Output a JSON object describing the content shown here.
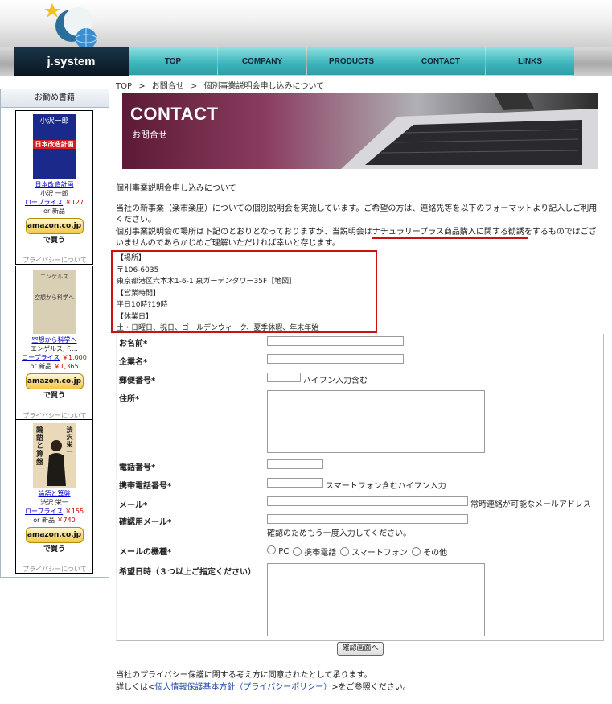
{
  "logo": {
    "text": "j.system"
  },
  "nav": [
    "TOP",
    "COMPANY",
    "PRODUCTS",
    "CONTACT",
    "LINKS"
  ],
  "breadcrumb": [
    "TOP",
    ">",
    "お問合せ",
    ">",
    "個別事業説明会申し込みについて"
  ],
  "sidebar": {
    "title": "お勧め書籍",
    "books": [
      {
        "cover_top": "小沢一郎",
        "cover_main": "日本改造計画",
        "title": "日本改造計画",
        "author": "小沢 一郎",
        "price_label": "ロープライス",
        "price": "￥127",
        "new_label": "or 新品",
        "new_price": "",
        "amazon": "amazon.co.jp で買う",
        "privacy": "プライバシーについて"
      },
      {
        "cover_top": "エンゲルス",
        "cover_main": "空想から科学へ",
        "title": "空想から科学へ",
        "author": "エンゲルス, F.…",
        "price_label": "ロープライス",
        "price": "￥1,000",
        "new_label": "or 新品",
        "new_price": "￥1,365",
        "amazon": "amazon.co.jp で買う",
        "privacy": "プライバシーについて"
      },
      {
        "cover_top": "渋沢栄一",
        "cover_main": "論語と算盤",
        "title": "論語と算盤",
        "author": "渋沢 栄一",
        "price_label": "ロープライス",
        "price": "￥155",
        "new_label": "or 新品",
        "new_price": "￥740",
        "amazon": "amazon.co.jp で買う",
        "privacy": "プライバシーについて"
      }
    ]
  },
  "banner": {
    "title": "CONTACT",
    "subtitle": "お問合せ"
  },
  "page": {
    "heading": "個別事業説明会申し込みについて",
    "intro1": "当社の新事業（楽市楽座）についての個別説明会を実施しています。ご希望の方は、連絡先等を以下のフォーマットより記入しご利用ください。",
    "intro2": "個別事業説明会の場所は下記のとおりとなっておりますが、当説明会はナチュラリープラス商品購入に関する勧誘をするものではございませんのであらかじめご理解いただければ幸いと存じます。"
  },
  "info": {
    "place_label": "【場所】",
    "postal": "〒106-6035",
    "address": "東京都港区六本木1-6-1 泉ガーデンタワー35F［地図］",
    "hours_label": "【営業時間】",
    "hours": "平日10時?19時",
    "holiday_label": "【休業日】",
    "holidays": "土・日曜日、祝日、ゴールデンウィーク、夏季休暇、年末年始"
  },
  "form": {
    "name": "お名前*",
    "company": "企業名*",
    "zip": "郵便番号*",
    "zip_note": "ハイフン入力含む",
    "address": "住所*",
    "phone": "電話番号*",
    "mobile": "携帯電話番号*",
    "mobile_note": "スマートフォン含むハイフン入力",
    "email": "メール*",
    "email_note": "常時連絡が可能なメールアドレス",
    "email_confirm": "確認用メール*",
    "email_confirm_note": "確認のためもう一度入力してください。",
    "device": "メールの機種*",
    "device_options": [
      "PC",
      "携帯電話",
      "スマートフォン",
      "その他"
    ],
    "dates": "希望日時（３つ以上ご指定ください）",
    "submit": "確認画面へ"
  },
  "footer": {
    "line1": "当社のプライバシー保護に関する考え方に同意されたとして承ります。",
    "line2_pre": "詳しくは<",
    "line2_link": "個人情報保護基本方針（プライバシーポリシー）",
    "line2_post": ">をご参照ください。"
  }
}
